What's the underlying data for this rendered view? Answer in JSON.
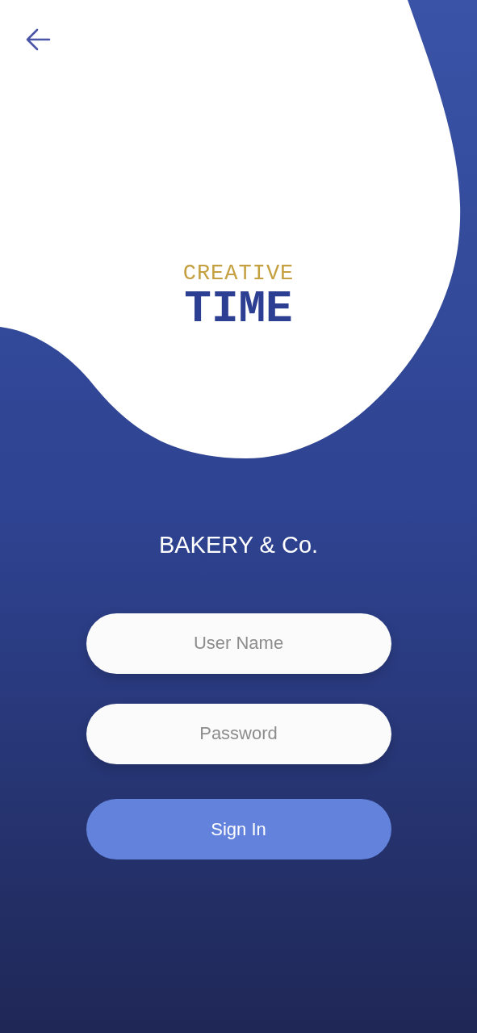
{
  "logo": {
    "line_1": "CREATIVE",
    "line_2": "TIME"
  },
  "brand": "BAKERY & Co.",
  "fields": [
    {
      "placeholder": "User Name"
    },
    {
      "placeholder": "Password"
    }
  ],
  "button": "Sign In"
}
